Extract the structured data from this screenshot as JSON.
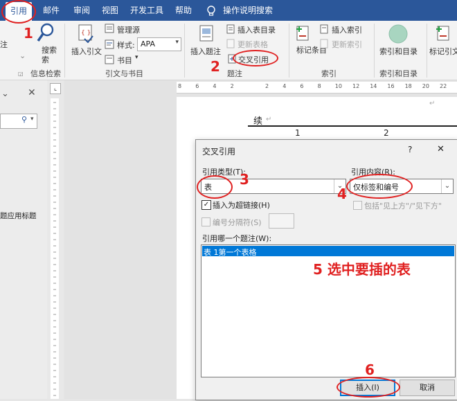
{
  "tabs": [
    "引用",
    "邮件",
    "审阅",
    "视图",
    "开发工具",
    "帮助"
  ],
  "tell_me": "操作说明搜索",
  "ribbon": {
    "left_cut_label": "注",
    "search": "搜索",
    "insert_citation": "插入引文",
    "manage_sources": "管理源",
    "style_label": "样式:",
    "style_value": "APA",
    "bibliography": "书目",
    "insert_caption": "插入题注",
    "insert_table_of_figures": "插入表目录",
    "update_table": "更新表格",
    "cross_reference": "交叉引用",
    "mark_entry": "标记条目",
    "insert_index": "插入索引",
    "update_index": "更新索引",
    "index_and_toc": "索引和目录",
    "mark_citation": "标记引文",
    "groups": {
      "info": "信息检索",
      "citations": "引文与书目",
      "captions": "题注",
      "index": "索引",
      "toa": "索引和目录"
    }
  },
  "left_pane": {
    "partial_text": "题应用标题"
  },
  "ruler": [
    "8",
    "6",
    "4",
    "2",
    "",
    "2",
    "4",
    "6",
    "8",
    "10",
    "12",
    "14",
    "16",
    "18",
    "20",
    "22"
  ],
  "document": {
    "continued": "续",
    "col1": "1",
    "col2": "2"
  },
  "dialog": {
    "title": "交叉引用",
    "help": "?",
    "close": "✕",
    "ref_type_label": "引用类型(T):",
    "ref_type_value": "表",
    "ref_content_label": "引用内容(R):",
    "ref_content_value": "仅标签和编号",
    "insert_hyperlink": "插入为超链接(H)",
    "include_above_below": "包括\"见上方\"/\"见下方\"",
    "separate_numbers": "编号分隔符(S)",
    "which_caption_label": "引用哪一个题注(W):",
    "captions": [
      "表 1第一个表格"
    ],
    "insert_button": "插入(I)",
    "cancel_button": "取消"
  },
  "annotations": {
    "n1": "1",
    "n2": "2",
    "n3": "3",
    "n4": "4",
    "n5": "5 选中要插的表",
    "n6": "6"
  },
  "colors": {
    "accent": "#2b579a",
    "annotation": "#e02020",
    "selection": "#0078d7"
  }
}
